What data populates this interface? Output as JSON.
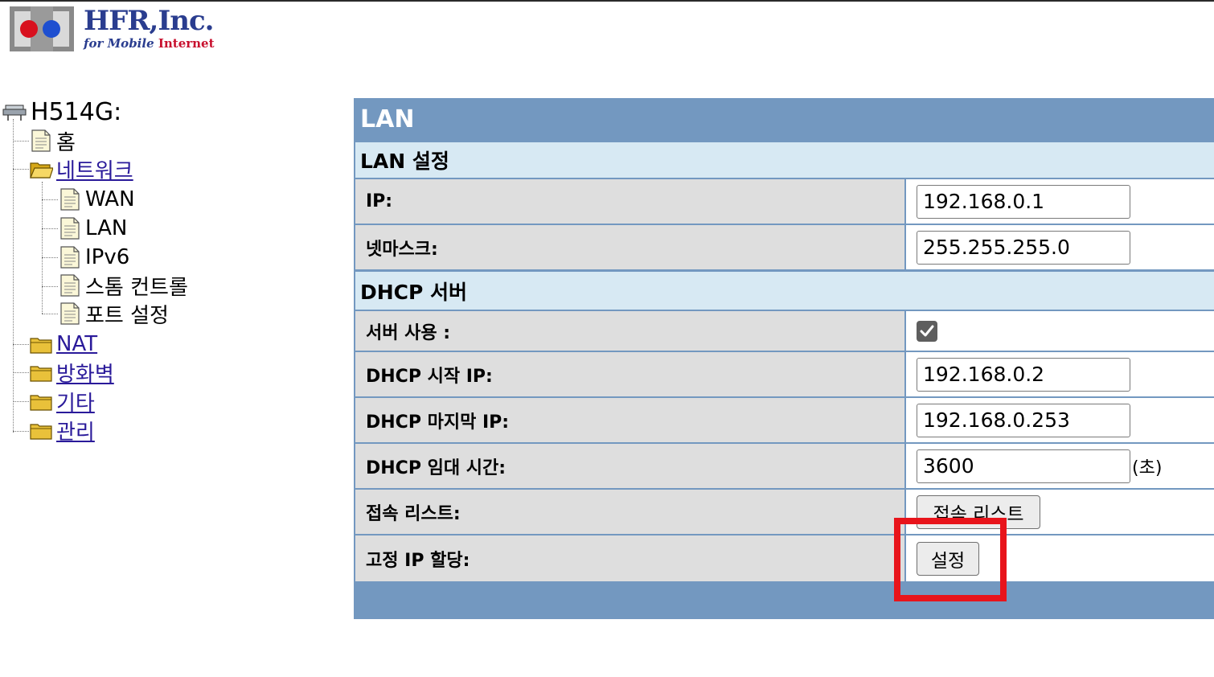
{
  "brand": {
    "name": "HFR,Inc.",
    "tagline_prefix": "for Mobile ",
    "tagline_red": "Internet",
    "colors": {
      "navy": "#2a3d8f",
      "red": "#c8102e"
    }
  },
  "tree": {
    "root": "H514G:",
    "items": [
      {
        "label": "홈",
        "icon": "page-icon",
        "link": false
      },
      {
        "label": "네트워크",
        "icon": "folder-open-icon",
        "link": true
      },
      {
        "label": "WAN",
        "icon": "page-icon",
        "link": false
      },
      {
        "label": "LAN",
        "icon": "page-icon",
        "link": false
      },
      {
        "label": "IPv6",
        "icon": "page-icon",
        "link": false
      },
      {
        "label": "스톰 컨트롤",
        "icon": "page-icon",
        "link": false
      },
      {
        "label": "포트 설정",
        "icon": "page-icon",
        "link": false
      },
      {
        "label": "NAT",
        "icon": "folder-icon",
        "link": true
      },
      {
        "label": "방화벽",
        "icon": "folder-icon",
        "link": true
      },
      {
        "label": "기타",
        "icon": "folder-icon",
        "link": true
      },
      {
        "label": "관리",
        "icon": "folder-icon",
        "link": true
      }
    ]
  },
  "panel": {
    "title": "LAN",
    "lan_section": "LAN 설정",
    "ip": {
      "label": "IP:",
      "value": "192.168.0.1"
    },
    "netmask": {
      "label": "넷마스크:",
      "value": "255.255.255.0"
    },
    "dhcp_section": "DHCP 서버",
    "server_use": {
      "label": "서버 사용 :",
      "checked": true
    },
    "dhcp_start": {
      "label": "DHCP 시작 IP:",
      "value": "192.168.0.2"
    },
    "dhcp_end": {
      "label": "DHCP 마지막 IP:",
      "value": "192.168.0.253"
    },
    "lease": {
      "label": "DHCP 임대 시간:",
      "value": "3600",
      "unit": "(초)"
    },
    "client_list": {
      "label": "접속 리스트:",
      "button": "접속 리스트"
    },
    "static_ip": {
      "label": "고정 IP 할당:",
      "button": "설정"
    }
  },
  "colors": {
    "panel_header": "#7398c0",
    "section_bg": "#d7e9f3",
    "label_bg": "#dedede",
    "highlight": "#e8141b"
  }
}
